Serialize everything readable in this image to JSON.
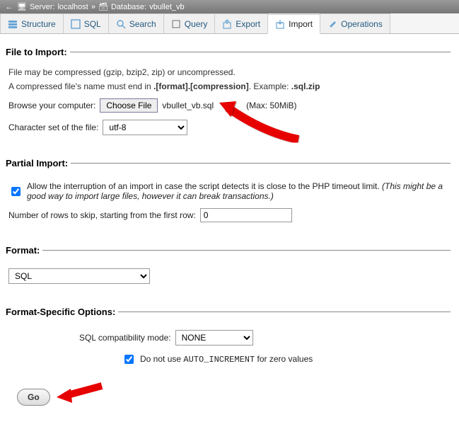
{
  "breadcrumb": {
    "server_label": "Server:",
    "server_value": "localhost",
    "separator": "»",
    "database_label": "Database:",
    "database_value": "vbullet_vb"
  },
  "tabs": {
    "structure": "Structure",
    "sql": "SQL",
    "search": "Search",
    "query": "Query",
    "export": "Export",
    "import": "Import",
    "operations": "Operations"
  },
  "file_import": {
    "legend": "File to Import:",
    "desc_line1": "File may be compressed (gzip, bzip2, zip) or uncompressed.",
    "desc_line2_a": "A compressed file's name must end in ",
    "desc_line2_b": ".[format].[compression]",
    "desc_line2_c": ". Example: ",
    "desc_line2_d": ".sql.zip",
    "browse_label": "Browse your computer:",
    "choose_button": "Choose File",
    "filename": "vbullet_vb.sql",
    "max_label": "(Max: 50MiB)",
    "charset_label": "Character set of the file:",
    "charset_value": "utf-8"
  },
  "partial_import": {
    "legend": "Partial Import:",
    "checkbox_label_a": "Allow the interruption of an import in case the script detects it is close to the PHP timeout limit. ",
    "checkbox_label_b": "(This might be a good way to import large files, however it can break transactions.)",
    "checkbox_checked": true,
    "rows_label": "Number of rows to skip, starting from the first row:",
    "rows_value": "0"
  },
  "format": {
    "legend": "Format:",
    "value": "SQL"
  },
  "format_options": {
    "legend": "Format-Specific Options:",
    "compat_label": "SQL compatibility mode:",
    "compat_value": "NONE",
    "autoinc_checked": true,
    "autoinc_label_a": "Do not use ",
    "autoinc_label_b": "AUTO_INCREMENT",
    "autoinc_label_c": " for zero values"
  },
  "go_button": "Go"
}
